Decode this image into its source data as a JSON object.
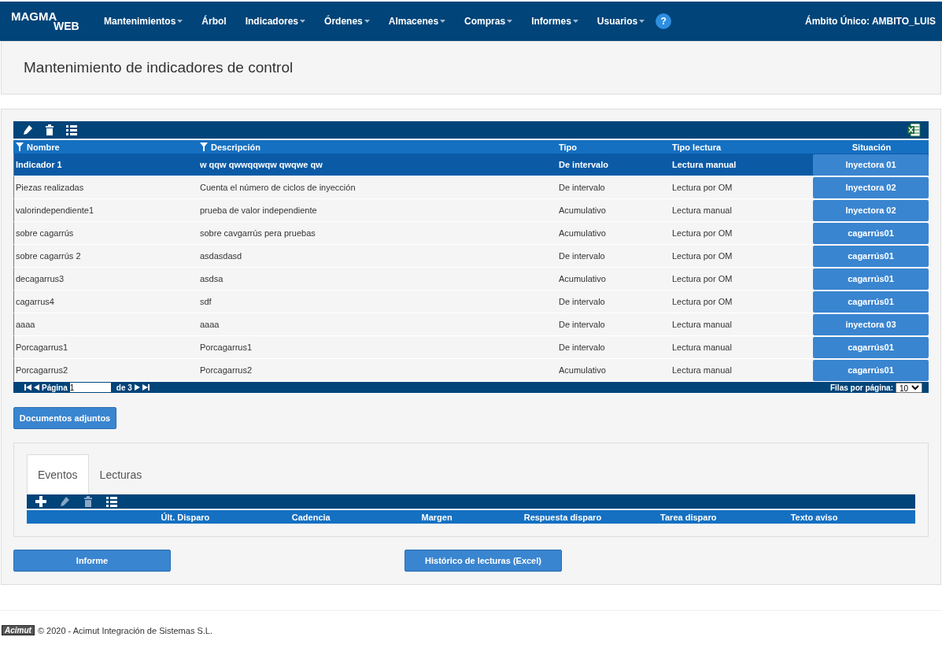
{
  "navbar": {
    "logo_top": "MAGMA",
    "logo_bottom": "WEB",
    "menu": [
      {
        "label": "Mantenimientos",
        "dropdown": true
      },
      {
        "label": "Árbol",
        "dropdown": false
      },
      {
        "label": "Indicadores",
        "dropdown": true
      },
      {
        "label": "Órdenes",
        "dropdown": true
      },
      {
        "label": "Almacenes",
        "dropdown": true
      },
      {
        "label": "Compras",
        "dropdown": true
      },
      {
        "label": "Informes",
        "dropdown": true
      },
      {
        "label": "Usuarios",
        "dropdown": true
      }
    ],
    "help": "?",
    "scope": "Ámbito Único: AMBITO_LUIS"
  },
  "page_title": "Mantenimiento de indicadores de control",
  "table": {
    "columns": [
      {
        "label": "Nombre",
        "filter": true
      },
      {
        "label": "Descripción",
        "filter": true
      },
      {
        "label": "Tipo",
        "filter": false
      },
      {
        "label": "Tipo lectura",
        "filter": false
      },
      {
        "label": "Situación",
        "filter": false
      }
    ],
    "rows": [
      {
        "selected": true,
        "cells": [
          "Indicador 1",
          "w qqw qwwqqwqw qwqwe qw",
          "De intervalo",
          "Lectura manual",
          "Inyectora 01"
        ]
      },
      {
        "selected": false,
        "cells": [
          "Piezas realizadas",
          "Cuenta el número de ciclos de inyección",
          "De intervalo",
          "Lectura por OM",
          "Inyectora 02"
        ]
      },
      {
        "selected": false,
        "cells": [
          "valorindependiente1",
          "prueba de valor independiente",
          "Acumulativo",
          "Lectura manual",
          "Inyectora 02"
        ]
      },
      {
        "selected": false,
        "cells": [
          "sobre cagarrús",
          "sobre cavgarrús pera pruebas",
          "Acumulativo",
          "Lectura por OM",
          "cagarrús01"
        ]
      },
      {
        "selected": false,
        "cells": [
          "sobre cagarrús 2",
          "asdasdasd",
          "De intervalo",
          "Lectura por OM",
          "cagarrús01"
        ]
      },
      {
        "selected": false,
        "cells": [
          "decagarrus3",
          "asdsa",
          "Acumulativo",
          "Lectura por OM",
          "cagarrús01"
        ]
      },
      {
        "selected": false,
        "cells": [
          "cagarrus4",
          "sdf",
          "De intervalo",
          "Lectura por OM",
          "cagarrús01"
        ]
      },
      {
        "selected": false,
        "cells": [
          "aaaa",
          "aaaa",
          "De intervalo",
          "Lectura manual",
          "inyectora 03"
        ]
      },
      {
        "selected": false,
        "cells": [
          "Porcagarrus1",
          "Porcagarrus1",
          "De intervalo",
          "Lectura manual",
          "cagarrús01"
        ]
      },
      {
        "selected": false,
        "cells": [
          "Porcagarrus2",
          "Porcagarrus2",
          "Acumulativo",
          "Lectura manual",
          "cagarrús01"
        ]
      }
    ],
    "pager": {
      "page_label": "Página",
      "page_value": "1",
      "of_label": "de 3",
      "rows_label": "Filas por página:",
      "rows_value": "10"
    }
  },
  "attachments_button": "Documentos adjuntos",
  "detail_tabs": [
    {
      "label": "Eventos",
      "selected": true
    },
    {
      "label": "Lecturas",
      "selected": false
    }
  ],
  "events_table": {
    "columns": [
      "Últ. Disparo",
      "Cadencia",
      "Margen",
      "Respuesta disparo",
      "Tarea disparo",
      "Texto aviso"
    ]
  },
  "buttons": [
    "Informe",
    "Histórico de lecturas (Excel)"
  ],
  "footer": {
    "logo": "Acimut",
    "text": "© 2020 - Acimut Integración de Sistemas S.L."
  }
}
